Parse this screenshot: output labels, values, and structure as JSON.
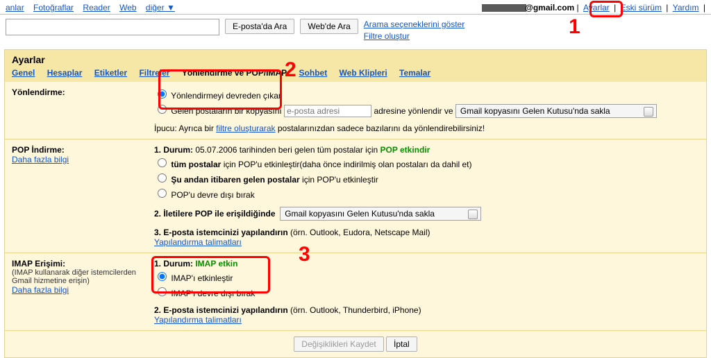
{
  "topnav": {
    "anlar": "anlar",
    "foto": "Fotoğraflar",
    "reader": "Reader",
    "web": "Web",
    "diger": "diğer",
    "caret": "▼"
  },
  "topright": {
    "email_suffix": "@gmail.com",
    "ayarlar": "Ayarlar",
    "eski": "Eski sürüm",
    "yardim": "Yardım",
    "sep": " | "
  },
  "search": {
    "btn_mail": "E-posta'da Ara",
    "btn_web": "Web'de Ara",
    "adv": "Arama seçeneklerini göster",
    "filter": "Filtre oluştur"
  },
  "settings": {
    "title": "Ayarlar",
    "tabs": {
      "genel": "Genel",
      "hesaplar": "Hesaplar",
      "etiketler": "Etiketler",
      "filtreler": "Filtreler",
      "fw": "Yönlendirme ve POP/IMAP",
      "sohbet": "Sohbet",
      "klip": "Web Klipleri",
      "tema": "Temalar"
    },
    "fw": {
      "label": "Yönlendirme:",
      "opt_disable": "Yönlendirmeyi devreden çıkar",
      "opt_copy_pre": "Gelen postaların bir kopyasını ",
      "opt_copy_placeholder": "e-posta adresi",
      "opt_copy_mid": " adresine yönlendir ve ",
      "select": "Gmail kopyasını Gelen Kutusu'nda sakla",
      "hint_pre": "İpucu: Ayrıca bir ",
      "hint_link": "filtre oluşturarak",
      "hint_post": " postalarınızdan sadece bazılarını da yönlendirebilirsiniz!"
    },
    "pop": {
      "label": "POP İndirme:",
      "more": "Daha fazla bilgi",
      "l1_pre": "1. Durum:",
      "l1_mid": " 05.07.2006 tarihinden beri gelen tüm postalar için ",
      "l1_green": "POP etkindir",
      "opt_all_pre": "tüm postalar",
      "opt_all_post": " için POP'u etkinleştir(daha önce indirilmiş olan postaları da dahil et)",
      "opt_now_pre": "Şu andan itibaren gelen postalar",
      "opt_now_post": " için POP'u etkinleştir",
      "opt_off": "POP'u devre dışı bırak",
      "l2": "2. İletilere POP ile erişildiğinde",
      "select": "Gmail kopyasını Gelen Kutusu'nda sakla",
      "l3_pre": "3. E-posta istemcinizi yapılandırın",
      "l3_post": " (örn. Outlook, Eudora, Netscape Mail)",
      "cfg": "Yapılandırma talimatları"
    },
    "imap": {
      "label": "IMAP Erişimi:",
      "sub": "(IMAP kullanarak diğer istemcilerden Gmail hizmetine erişin)",
      "more": "Daha fazla bilgi",
      "l1_pre": "1. Durum: ",
      "l1_green": "IMAP etkin",
      "opt_on": "IMAP'ı etkinleştir",
      "opt_off": "IMAP'ı devre dışı bırak",
      "l2_pre": "2. E-posta istemcinizi yapılandırın",
      "l2_post": " (örn. Outlook, Thunderbird, iPhone)",
      "cfg": "Yapılandırma talimatları"
    },
    "footer": {
      "save": "Değişiklikleri Kaydet",
      "cancel": "İptal"
    }
  }
}
